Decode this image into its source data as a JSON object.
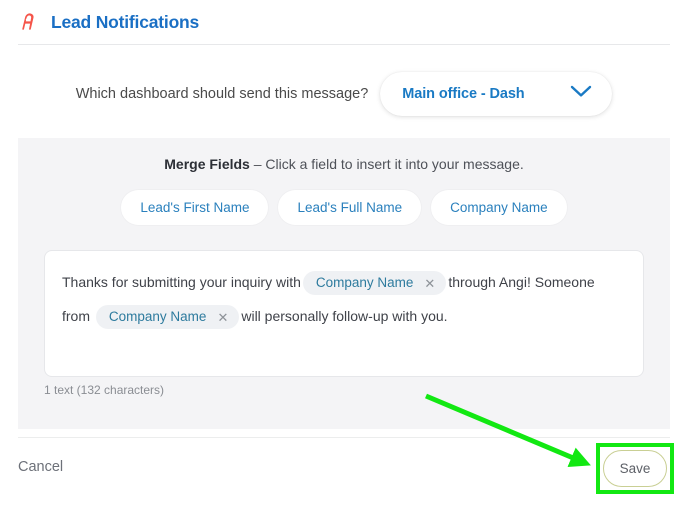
{
  "header": {
    "logo_icon": "angi-a-logo-icon",
    "title": "Lead Notifications",
    "title_color": "#1a6fc4",
    "logo_color": "#f5554a"
  },
  "selector": {
    "label": "Which dashboard should send this message?",
    "dropdown_value": "Main office - Dash",
    "dropdown_icon": "chevron-down-icon",
    "value_color": "#1a7ac4"
  },
  "merge_fields": {
    "heading_bold": "Merge Fields",
    "heading_rest": " – Click a field to insert it into your message.",
    "pills": [
      {
        "label": "Lead's First Name"
      },
      {
        "label": "Lead's Full Name"
      },
      {
        "label": "Company Name"
      }
    ],
    "pill_text_color": "#2a80bd"
  },
  "composer": {
    "text_part_1": "Thanks for submitting your inquiry with",
    "tag_1_label": "Company Name",
    "text_part_2": "through Angi! Someone from",
    "tag_2_label": "Company Name",
    "text_part_3": "will personally follow-up with you.",
    "remove_icon": "close-x-icon",
    "tag_color": "#2e7b9e",
    "char_count": "1 text (132 characters)"
  },
  "footer": {
    "cancel_label": "Cancel",
    "save_label": "Save",
    "save_border_color": "#c9cf94"
  },
  "annotation": {
    "arrow_icon": "green-arrow-pointer-icon",
    "highlight_icon": "green-highlight-box-icon",
    "color": "#12e812"
  }
}
